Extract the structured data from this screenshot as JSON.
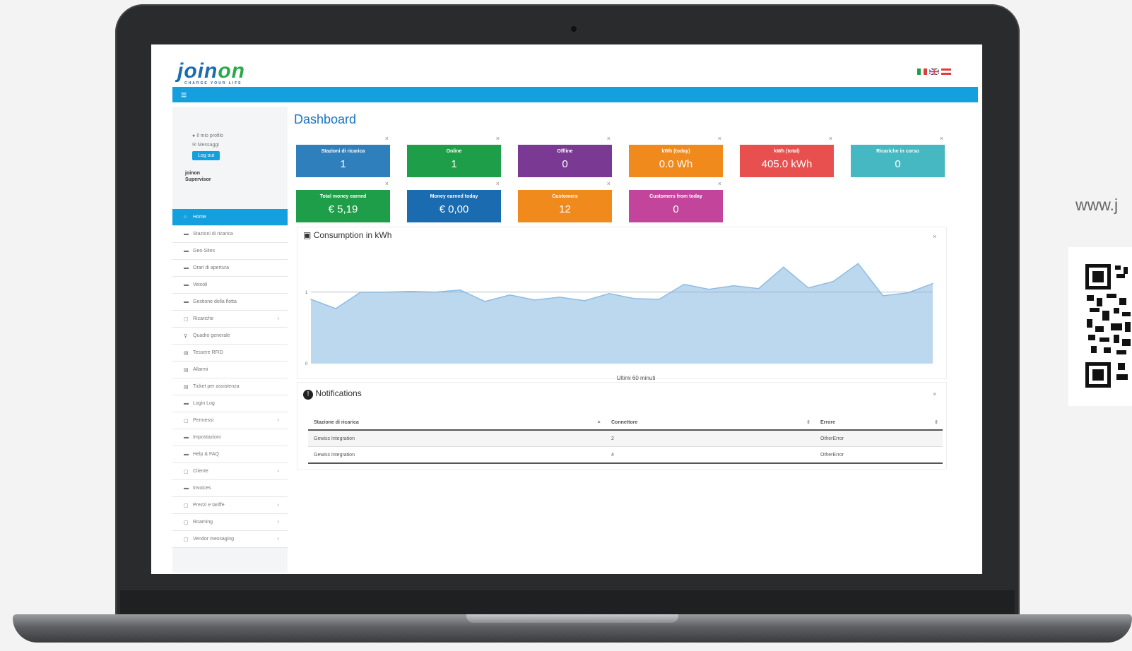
{
  "app": {
    "brand": "join",
    "brand_suffix": "on",
    "brand_tagline": "CHARGE YOUR LIFE",
    "flags": [
      "it-flag",
      "uk-flag",
      "at-flag"
    ]
  },
  "sidebar": {
    "profile_link": "Il mio profilo",
    "messages_link": "Messaggi",
    "logout_label": "Log out",
    "user_name": "joinon",
    "user_role": "Supervisor",
    "items": [
      {
        "label": "Home",
        "icon": "home-icon"
      },
      {
        "label": "Stazioni di ricarica",
        "icon": "folder-icon"
      },
      {
        "label": "Geo-Sites",
        "icon": "folder-icon"
      },
      {
        "label": "Orari di apertura",
        "icon": "folder-icon"
      },
      {
        "label": "Veicoli",
        "icon": "folder-icon"
      },
      {
        "label": "Gestione della flotta",
        "icon": "folder-icon"
      },
      {
        "label": "Ricariche",
        "icon": "square-icon",
        "arrow": "‹"
      },
      {
        "label": "Quadro generale",
        "icon": "pin-icon"
      },
      {
        "label": "Tessere RFID",
        "icon": "list-icon"
      },
      {
        "label": "Allarmi",
        "icon": "list-icon"
      },
      {
        "label": "Ticket per assistenza",
        "icon": "list-icon"
      },
      {
        "label": "Login Log",
        "icon": "folder-icon"
      },
      {
        "label": "Permessi",
        "icon": "square-icon",
        "arrow": "‹"
      },
      {
        "label": "Impostazioni",
        "icon": "folder-icon"
      },
      {
        "label": "Help & FAQ",
        "icon": "folder-icon"
      },
      {
        "label": "Cliente",
        "icon": "square-icon",
        "arrow": "‹"
      },
      {
        "label": "Invoices",
        "icon": "folder-icon"
      },
      {
        "label": "Prezzi e tariffe",
        "icon": "square-icon",
        "arrow": "‹"
      },
      {
        "label": "Roaming",
        "icon": "square-icon",
        "arrow": "‹"
      },
      {
        "label": "Vendor messaging",
        "icon": "square-icon",
        "arrow": "‹"
      }
    ]
  },
  "main": {
    "title": "Dashboard",
    "close_glyph": "×",
    "cards": [
      {
        "label": "Stazioni di ricarica",
        "value": "1",
        "color": "#2f7fbc"
      },
      {
        "label": "Online",
        "value": "1",
        "color": "#1f9e49"
      },
      {
        "label": "Offline",
        "value": "0",
        "color": "#7a3a93"
      },
      {
        "label": "kWh (today)",
        "value": "0.0 Wh",
        "color": "#f08a1c"
      },
      {
        "label": "kWh (total)",
        "value": "405.0 kWh",
        "color": "#e7504f"
      },
      {
        "label": "Ricariche in corso",
        "value": "0",
        "color": "#46b8c2"
      },
      {
        "label": "Total money earned",
        "value": "€ 5,19",
        "color": "#1f9e49"
      },
      {
        "label": "Money earned today",
        "value": "€ 0,00",
        "color": "#1a6bb0"
      },
      {
        "label": "Customers",
        "value": "12",
        "color": "#f08a1c"
      },
      {
        "label": "Customers from today",
        "value": "0",
        "color": "#c2459b"
      }
    ],
    "consumption": {
      "title": "Consumption in kWh"
    },
    "notifications": {
      "title": "Notifications",
      "columns": [
        "Stazione di ricarica",
        "Connettore",
        "Errore"
      ],
      "rows": [
        [
          "Gewiss Integration",
          "2",
          "OtherError"
        ],
        [
          "Gewiss Integration",
          "4",
          "OtherError"
        ]
      ]
    }
  },
  "chart_data": {
    "type": "area",
    "title": "Consumption in kWh",
    "xlabel": "Ultimi 60 minuti",
    "ylabel": "",
    "ylim": [
      0,
      1.6
    ],
    "yticks": [
      "0",
      "1"
    ],
    "values": [
      0.9,
      0.77,
      1.0,
      1.0,
      1.01,
      1.0,
      1.03,
      0.87,
      0.96,
      0.89,
      0.93,
      0.88,
      0.98,
      0.91,
      0.9,
      1.11,
      1.04,
      1.09,
      1.05,
      1.35,
      1.06,
      1.15,
      1.4,
      0.95,
      0.99,
      1.12
    ],
    "reference_line": 1.0,
    "color": "#bcd8ef",
    "line_color": "#8fbce3"
  },
  "external": {
    "website": "www.j"
  }
}
